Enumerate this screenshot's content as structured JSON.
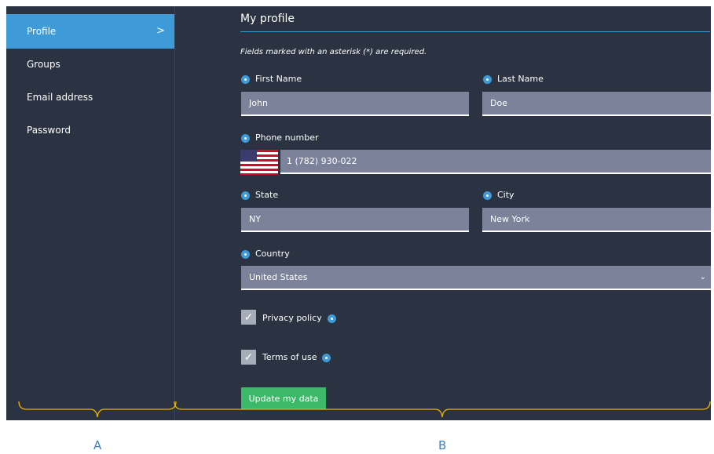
{
  "sidebar": {
    "items": [
      {
        "label": "Profile",
        "active": true,
        "chevron": ">"
      },
      {
        "label": "Groups"
      },
      {
        "label": "Email address"
      },
      {
        "label": "Password"
      }
    ]
  },
  "main": {
    "title": "My profile",
    "note": "Fields marked with an asterisk (*) are required.",
    "fields": {
      "first_name": {
        "label": "First Name",
        "value": "John"
      },
      "last_name": {
        "label": "Last Name",
        "value": "Doe"
      },
      "phone": {
        "label": "Phone number",
        "value": "1 (782) 930-022"
      },
      "state": {
        "label": "State",
        "value": "NY"
      },
      "city": {
        "label": "City",
        "value": "New York"
      },
      "country": {
        "label": "Country",
        "value": "United States"
      }
    },
    "checkboxes": {
      "privacy": {
        "label": "Privacy policy",
        "checked": true
      },
      "terms": {
        "label": "Terms of use",
        "checked": true
      }
    },
    "submit_label": "Update my data"
  },
  "annotations": {
    "a": "A",
    "b": "B"
  },
  "colors": {
    "background": "#2b3241",
    "accent": "#3e9bd8",
    "field": "#7b8299",
    "button": "#3cb869",
    "brace": "#f0b400",
    "annotation_text": "#3e7fc0"
  }
}
